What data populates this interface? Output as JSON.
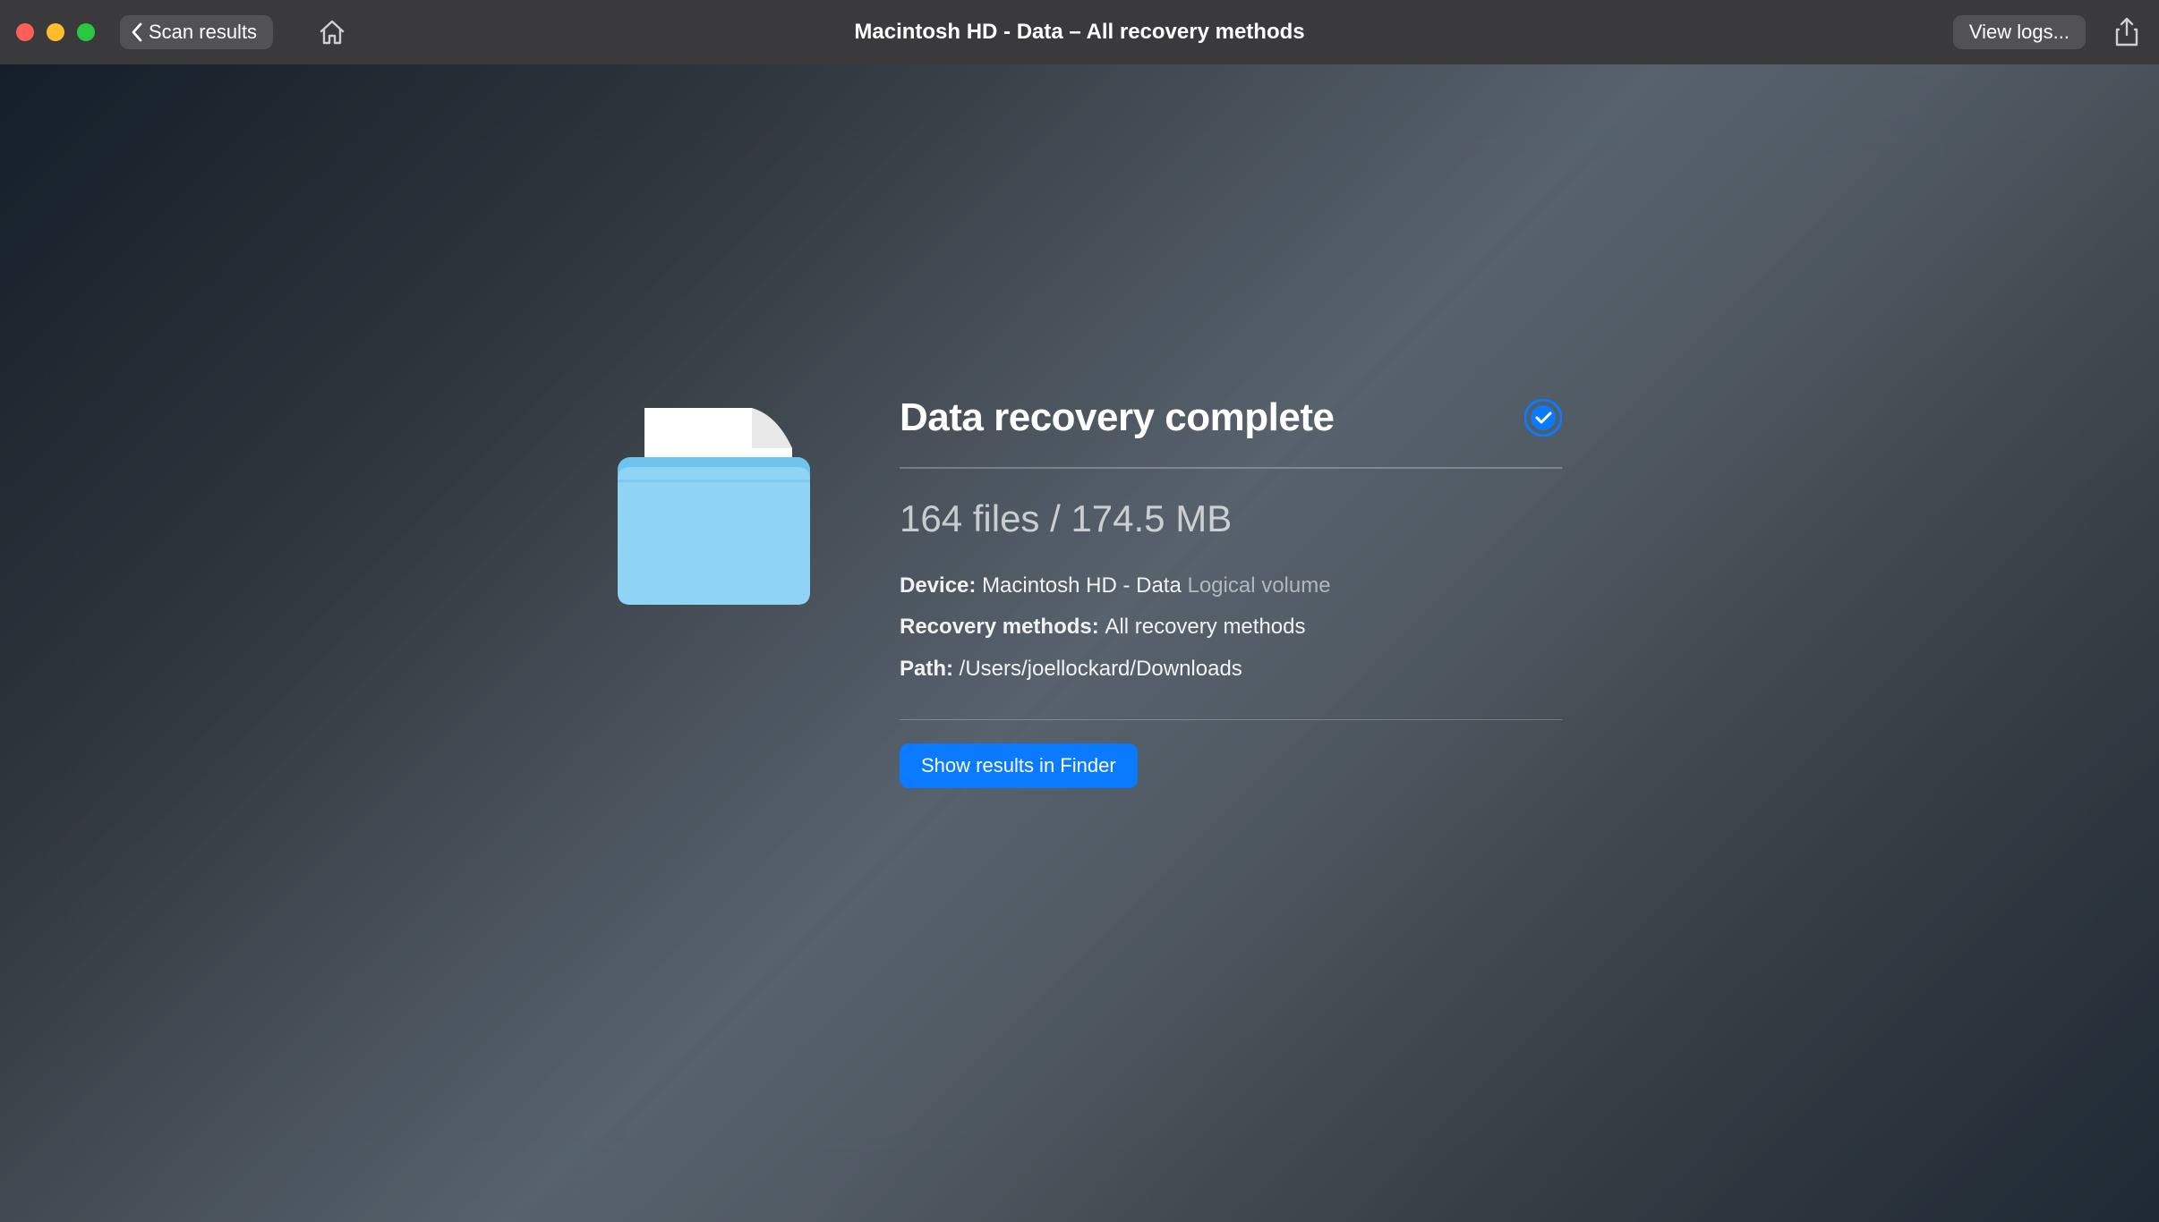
{
  "toolbar": {
    "back_label": "Scan results",
    "title": "Macintosh HD - Data – All recovery methods",
    "view_logs_label": "View logs..."
  },
  "result": {
    "heading": "Data recovery complete",
    "stats": "164 files / 174.5 MB",
    "device_label": "Device:",
    "device_value": "Macintosh HD - Data",
    "device_type": "Logical volume",
    "methods_label": "Recovery methods:",
    "methods_value": "All recovery methods",
    "path_label": "Path:",
    "path_value": "/Users/joellockard/Downloads",
    "show_finder_label": "Show results in Finder"
  },
  "colors": {
    "accent": "#0a7aff",
    "toolbar_bg": "#3a3a3c",
    "button_bg": "#525254"
  }
}
